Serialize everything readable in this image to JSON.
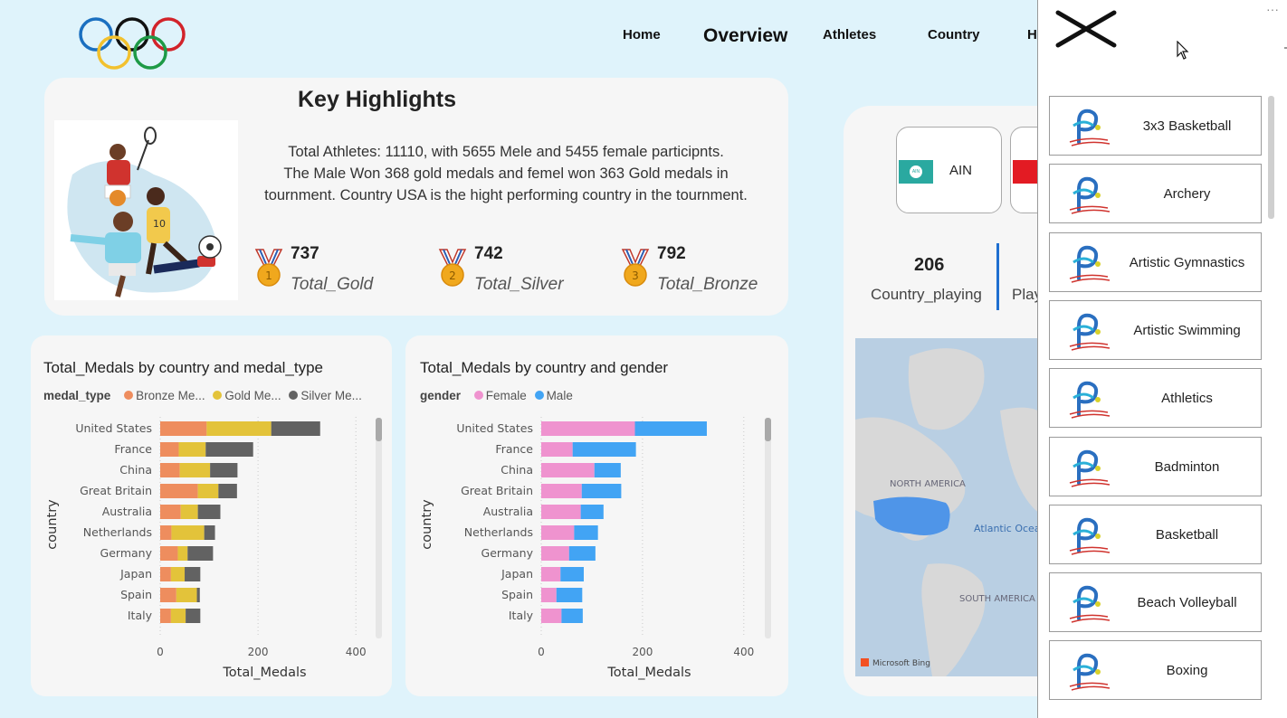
{
  "nav": {
    "home": "Home",
    "overview": "Overview",
    "athletes": "Athletes",
    "country": "Country",
    "partial": "H"
  },
  "key_highlights": {
    "title": "Key  Highlights",
    "lines": [
      "Total Athletes: 11110, with 5655 Mele and 5455 female participnts.",
      "The Male Won 368 gold medals and femel won 363 Gold medals in",
      "tournment. Country USA is the hight performing country in the tournment."
    ],
    "kpis": [
      {
        "value": "737",
        "label": "Total_Gold",
        "medal_num": "1"
      },
      {
        "value": "742",
        "label": "Total_Silver",
        "medal_num": "2"
      },
      {
        "value": "792",
        "label": "Total_Bronze",
        "medal_num": "3"
      }
    ]
  },
  "country_card": {
    "tiles": [
      {
        "label": "AIN",
        "flag_text": "AIN"
      }
    ],
    "count_value": "206",
    "count_label": "Country_playing",
    "partial_label": "Play",
    "map_labels": {
      "north_america": "NORTH AMERICA",
      "atlantic": "Atlantic Ocea",
      "south_america": "SOUTH AMERICA"
    },
    "bing": "Microsoft Bing"
  },
  "colors": {
    "bronze": "#ee8d5e",
    "gold": "#e3c33a",
    "silver": "#626262",
    "female": "#ef93cf",
    "male": "#42a4f4",
    "accent": "#1f6fd0"
  },
  "chart_data": [
    {
      "type": "bar",
      "orientation": "horizontal",
      "stacked": true,
      "title": "Total_Medals by country and medal_type",
      "legend_title": "medal_type",
      "legend_labels": [
        "Bronze Me...",
        "Gold Me...",
        "Silver Me..."
      ],
      "categories": [
        "United States",
        "France",
        "China",
        "Great Britain",
        "Australia",
        "Netherlands",
        "Germany",
        "Japan",
        "Spain",
        "Italy"
      ],
      "series": [
        {
          "name": "Bronze Medal",
          "values": [
            95,
            38,
            40,
            77,
            42,
            23,
            36,
            22,
            33,
            22
          ]
        },
        {
          "name": "Gold Medal",
          "values": [
            132,
            55,
            62,
            42,
            35,
            67,
            20,
            28,
            42,
            30
          ]
        },
        {
          "name": "Silver Medal",
          "values": [
            100,
            97,
            56,
            38,
            46,
            22,
            52,
            32,
            6,
            30
          ]
        }
      ],
      "xlabel": "Total_Medals",
      "ylabel": "country",
      "xticks": [
        "0",
        "200",
        "400"
      ],
      "xlim": [
        0,
        420
      ]
    },
    {
      "type": "bar",
      "orientation": "horizontal",
      "stacked": true,
      "title": "Total_Medals by country and gender",
      "legend_title": "gender",
      "categories": [
        "United States",
        "France",
        "China",
        "Great Britain",
        "Australia",
        "Netherlands",
        "Germany",
        "Japan",
        "Spain",
        "Italy"
      ],
      "series": [
        {
          "name": "Female",
          "values": [
            185,
            62,
            105,
            80,
            78,
            65,
            55,
            38,
            30,
            40
          ]
        },
        {
          "name": "Male",
          "values": [
            142,
            125,
            52,
            78,
            45,
            47,
            52,
            46,
            51,
            42
          ]
        }
      ],
      "xlabel": "Total_Medals",
      "ylabel": "country",
      "xticks": [
        "0",
        "200",
        "400"
      ],
      "xlim": [
        0,
        420
      ]
    }
  ],
  "sports": [
    "3x3 Basketball",
    "Archery",
    "Artistic Gymnastics",
    "Artistic Swimming",
    "Athletics",
    "Badminton",
    "Basketball",
    "Beach Volleyball",
    "Boxing"
  ],
  "panel": {
    "more": "···"
  }
}
